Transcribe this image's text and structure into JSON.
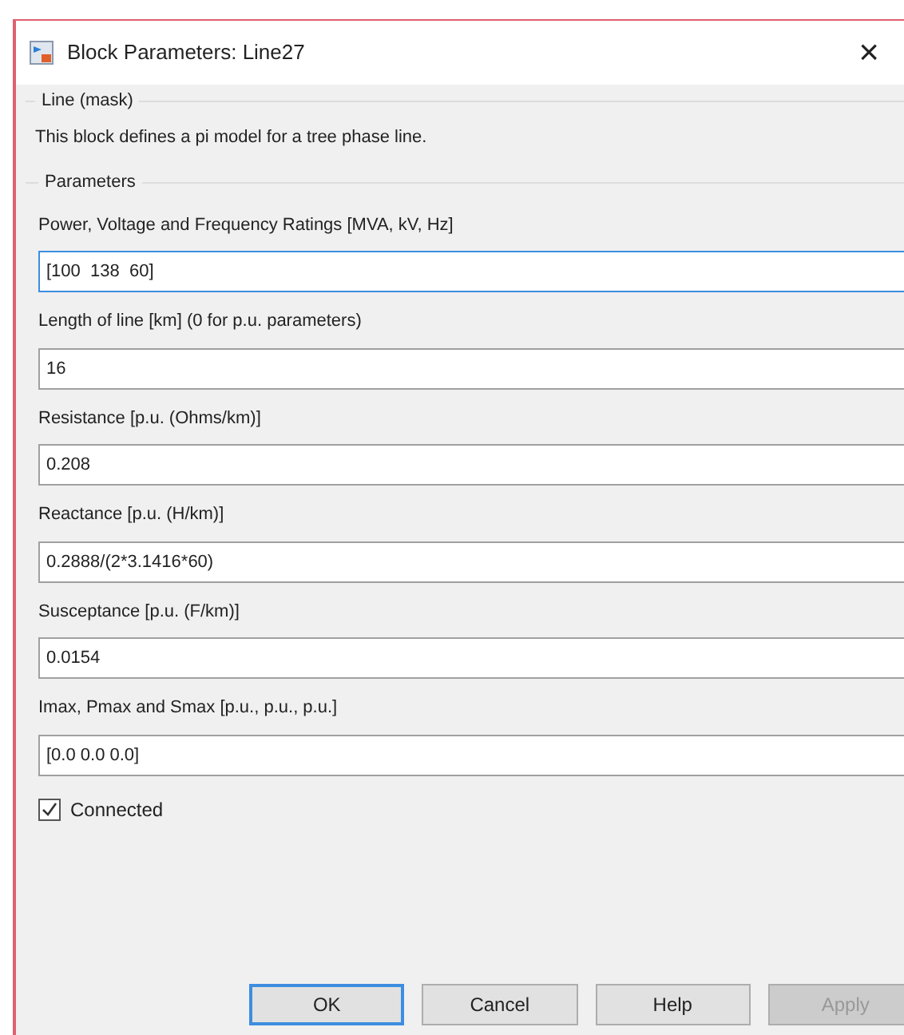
{
  "window": {
    "title": "Block Parameters: Line27",
    "close": "×"
  },
  "description_group": {
    "title": "Line (mask)",
    "text": "This block defines a pi model for a tree phase line."
  },
  "parameters_group": {
    "title": "Parameters",
    "fields": [
      {
        "label": "Power, Voltage and Frequency Ratings [MVA, kV, Hz]",
        "value": "[100  138  60]",
        "focused": true
      },
      {
        "label": "Length of line [km] (0 for p.u. parameters)",
        "value": "16",
        "focused": false
      },
      {
        "label": "Resistance [p.u. (Ohms/km)]",
        "value": "0.208",
        "focused": false
      },
      {
        "label": "Reactance [p.u. (H/km)]",
        "value": "0.2888/(2*3.1416*60)",
        "focused": false
      },
      {
        "label": "Susceptance [p.u. (F/km)]",
        "value": "0.0154",
        "focused": false
      },
      {
        "label": "Imax, Pmax and Smax [p.u., p.u., p.u.]",
        "value": "[0.0 0.0 0.0]",
        "focused": false
      }
    ],
    "checkbox": {
      "label": "Connected",
      "checked": true
    }
  },
  "buttons": [
    {
      "label": "OK",
      "default": true,
      "disabled": false
    },
    {
      "label": "Cancel",
      "default": false,
      "disabled": false
    },
    {
      "label": "Help",
      "default": false,
      "disabled": false
    },
    {
      "label": "Apply",
      "default": false,
      "disabled": true
    }
  ]
}
